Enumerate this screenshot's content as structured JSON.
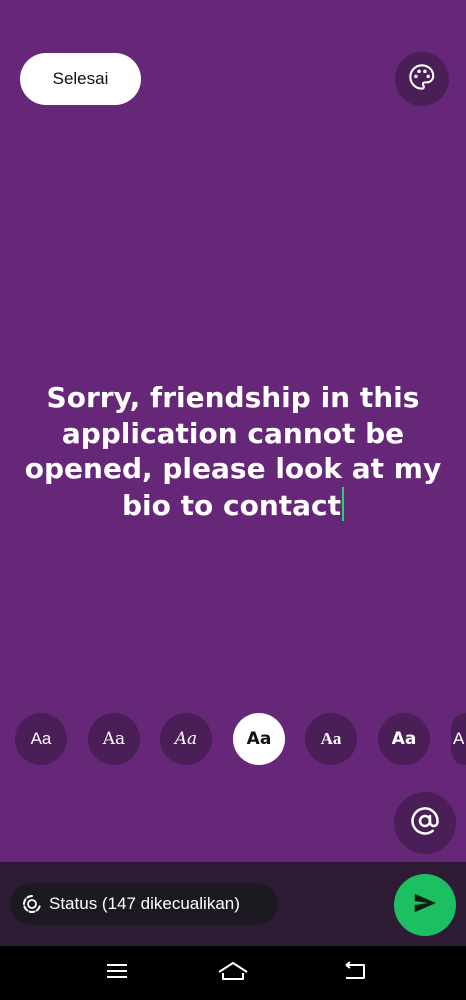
{
  "header": {
    "done_label": "Selesai",
    "palette_icon": "palette-icon"
  },
  "composer": {
    "text_lines": [
      "Sorry, friendship in this",
      "application cannot be",
      "opened, please look at my",
      "bio to contact"
    ],
    "background_color": "#672779",
    "cursor_color": "#25d366"
  },
  "font_options": [
    {
      "label": "Aa",
      "selected": false
    },
    {
      "label": "Aa",
      "selected": false
    },
    {
      "label": "Aa",
      "selected": false
    },
    {
      "label": "Aa",
      "selected": true
    },
    {
      "label": "Aa",
      "selected": false
    },
    {
      "label": "Aa",
      "selected": false
    },
    {
      "label": "A",
      "selected": false
    }
  ],
  "mention_icon": "at-sign-icon",
  "footer": {
    "status_label": "Status (147 dikecualikan)",
    "status_icon": "status-ring-icon",
    "send_icon": "send-icon",
    "send_color": "#1dbf63"
  },
  "nav": {
    "icons": [
      "menu-icon",
      "home-icon",
      "back-icon"
    ]
  }
}
